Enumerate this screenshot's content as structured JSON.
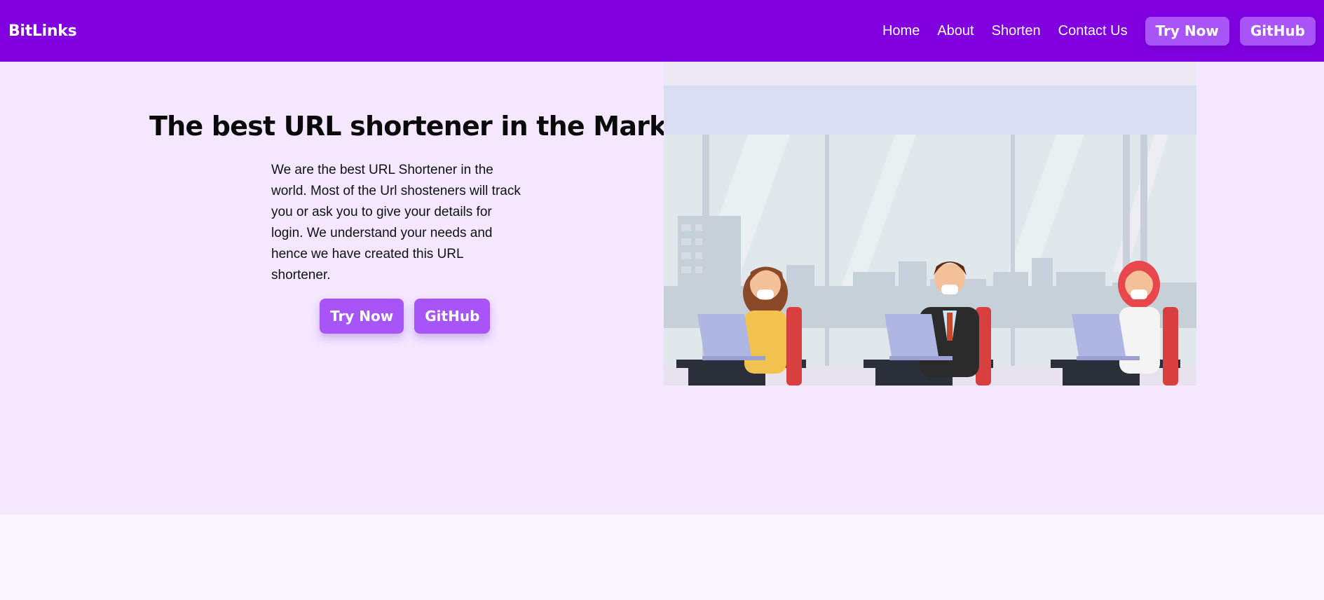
{
  "navbar": {
    "brand": "BitLinks",
    "links": [
      "Home",
      "About",
      "Shorten",
      "Contact Us"
    ],
    "try_now": "Try Now",
    "github": "GitHub"
  },
  "hero": {
    "title": "The best URL shortener in the Market",
    "description": "We are the best URL Shortener in the world. Most of the Url shosteners will track you or ask you to give your details for login. We understand your needs and hence we have created this URL shortener.",
    "try_now": "Try Now",
    "github": "GitHub"
  },
  "colors": {
    "navbar": "#8000e0",
    "button": "#a855f7",
    "hero_bg": "#f3e8ff",
    "page_bg": "#faf5ff"
  },
  "illustration": "office-workers-with-masks-illustration"
}
